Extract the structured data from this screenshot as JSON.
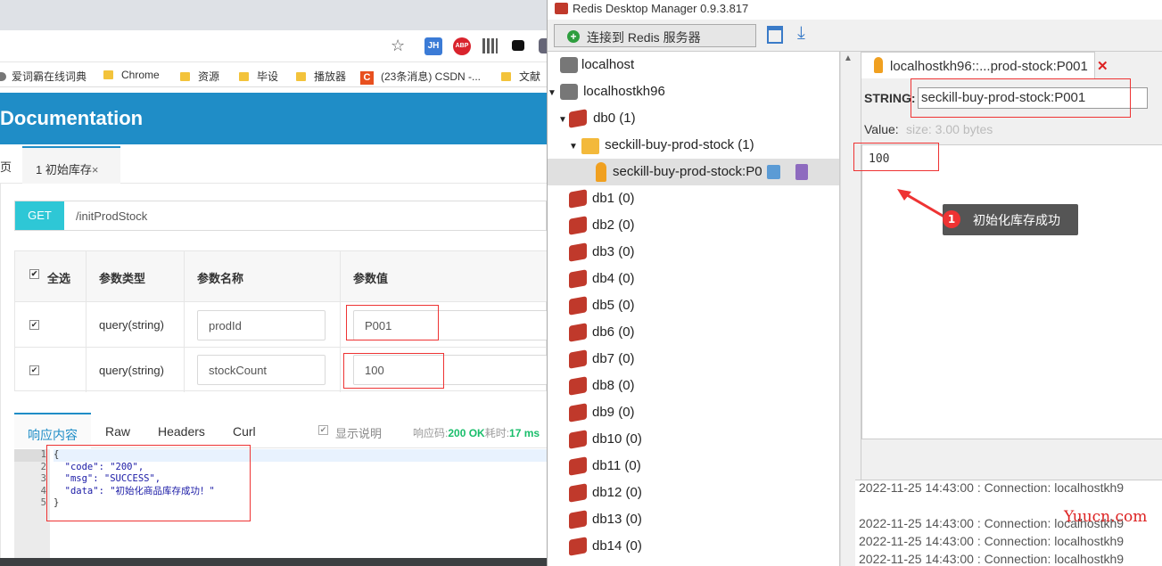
{
  "browser": {
    "toolbar_icons": {
      "jh": "JH",
      "abp": "ABP"
    },
    "bookmarks": [
      {
        "label": "爱词霸在线词典"
      },
      {
        "label": "Chrome"
      },
      {
        "label": "资源"
      },
      {
        "label": "毕设"
      },
      {
        "label": "播放器"
      },
      {
        "label": "(23条消息) CSDN -..."
      },
      {
        "label": "文献"
      }
    ],
    "doc_title": "Documentation",
    "tabs": {
      "prev_fragment": "页",
      "active": "1 初始库存",
      "close": "×"
    },
    "request": {
      "method": "GET",
      "url": "/initProdStock"
    },
    "params": {
      "headers": {
        "select_all": "全选",
        "type": "参数类型",
        "name": "参数名称",
        "value": "参数值"
      },
      "rows": [
        {
          "type": "query(string)",
          "name": "prodId",
          "value": "P001"
        },
        {
          "type": "query(string)",
          "name": "stockCount",
          "value": "100"
        }
      ]
    },
    "response": {
      "tabs": [
        "响应内容",
        "Raw",
        "Headers",
        "Curl"
      ],
      "show_desc": "显示说明",
      "code_label": "响应码:",
      "code_value": "200 OK",
      "time_label": "耗时:",
      "time_value": "17 ms",
      "lines": [
        "{",
        "  \"code\": \"200\",",
        "  \"msg\": \"SUCCESS\",",
        "  \"data\": \"初始化商品库存成功！\"",
        "}"
      ],
      "line_numbers": [
        "1",
        "2",
        "3",
        "4",
        "5"
      ]
    }
  },
  "redis": {
    "title": "Redis Desktop Manager 0.9.3.817",
    "connect_button": "连接到 Redis 服务器",
    "tree": {
      "localhost": "localhost",
      "conn": "localhostkh96",
      "db0": "db0  (1)",
      "folder": "seckill-buy-prod-stock (1)",
      "key": "seckill-buy-prod-stock:P0",
      "dbs": [
        "db1  (0)",
        "db2  (0)",
        "db3  (0)",
        "db4  (0)",
        "db5  (0)",
        "db6  (0)",
        "db7  (0)",
        "db8  (0)",
        "db9  (0)",
        "db10  (0)",
        "db11  (0)",
        "db12  (0)",
        "db13  (0)",
        "db14  (0)"
      ]
    },
    "key_tab": "localhostkh96::...prod-stock:P001",
    "key_tab_close": "✕",
    "type_label": "STRING:",
    "key_name": "seckill-buy-prod-stock:P001",
    "value_label": "Value:",
    "value_size": "size: 3.00 bytes",
    "value": "100",
    "log": [
      "2022-11-25 14:43:00 : Connection: localhostkh9",
      "2022-11-25 14:43:00 : Connection: localhostkh9",
      "2022-11-25 14:43:00 : Connection: localhostkh9",
      "2022-11-25 14:43:00 : Connection: localhostkh9"
    ]
  },
  "annotation": {
    "number": "1",
    "text": "初始化库存成功"
  },
  "watermark": "Yuucn.com",
  "colors": {
    "header_blue": "#1f8dc7",
    "get_cyan": "#2ec7d6",
    "highlight_red": "#e33",
    "success_green": "#19be6b"
  }
}
